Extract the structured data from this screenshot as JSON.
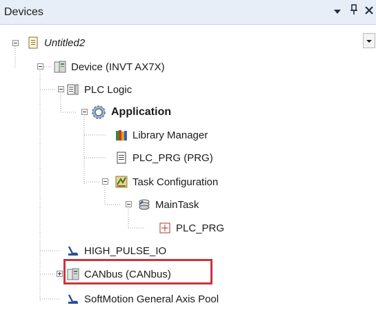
{
  "panel": {
    "title": "Devices",
    "dropdown_icon": "caret-down-icon",
    "pin_icon": "pin-icon",
    "close_icon": "close-icon"
  },
  "tree": {
    "project": {
      "label": "Untitled2",
      "icon": "project-file-icon"
    },
    "device": {
      "label": "Device (INVT AX7X)",
      "icon": "device-icon"
    },
    "plc_logic": {
      "label": "PLC Logic",
      "icon": "plc-logic-icon"
    },
    "application": {
      "label": "Application",
      "icon": "application-gear-icon"
    },
    "library_manager": {
      "label": "Library Manager",
      "icon": "library-books-icon"
    },
    "plc_prg": {
      "label": "PLC_PRG (PRG)",
      "icon": "program-document-icon"
    },
    "task_configuration": {
      "label": "Task Configuration",
      "icon": "task-configuration-icon"
    },
    "main_task": {
      "label": "MainTask",
      "icon": "task-icon"
    },
    "plc_prg_call": {
      "label": "PLC_PRG",
      "icon": "program-call-icon"
    },
    "high_pulse_io": {
      "label": "HIGH_PULSE_IO",
      "icon": "io-connector-icon"
    },
    "canbus": {
      "label": "CANbus (CANbus)",
      "icon": "device-icon"
    },
    "softmotion": {
      "label": "SoftMotion General Axis Pool",
      "icon": "io-connector-icon"
    }
  },
  "colors": {
    "titlebar_bg": "#e8eef7",
    "highlight_border": "#c8333a"
  }
}
